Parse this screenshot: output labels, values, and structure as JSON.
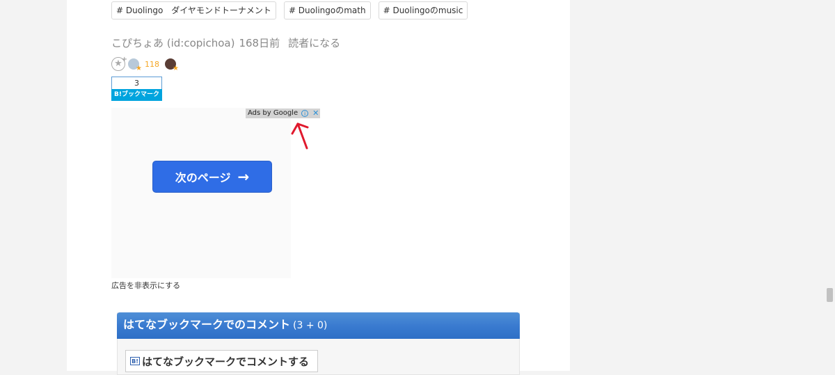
{
  "tags": [
    "# Duolingo　ダイヤモンドトーナメント",
    "# Duolingoのmath",
    "# Duolingoのmusic"
  ],
  "author": {
    "name": "こぴちょあ (id:copichoa)",
    "age": "168日前",
    "subscribe_label": "読者になる"
  },
  "stars": {
    "add_star_icon": "star-plus",
    "count": "118"
  },
  "bookmark": {
    "count": "3",
    "button_label": "B!ブックマーク"
  },
  "ad": {
    "label": "Ads by Google",
    "info_icon": "i",
    "close_icon": "✕",
    "next_button_label": "次のページ",
    "next_arrow": "→",
    "hide_ads_label": "広告を非表示にする",
    "arrow_color": "#e0192d"
  },
  "comments": {
    "header_title": "はてなブックマークでのコメント",
    "header_count": "(3 + 0)",
    "comment_button_icon": "B!",
    "comment_button_label": "はてなブックマークでコメントする"
  }
}
